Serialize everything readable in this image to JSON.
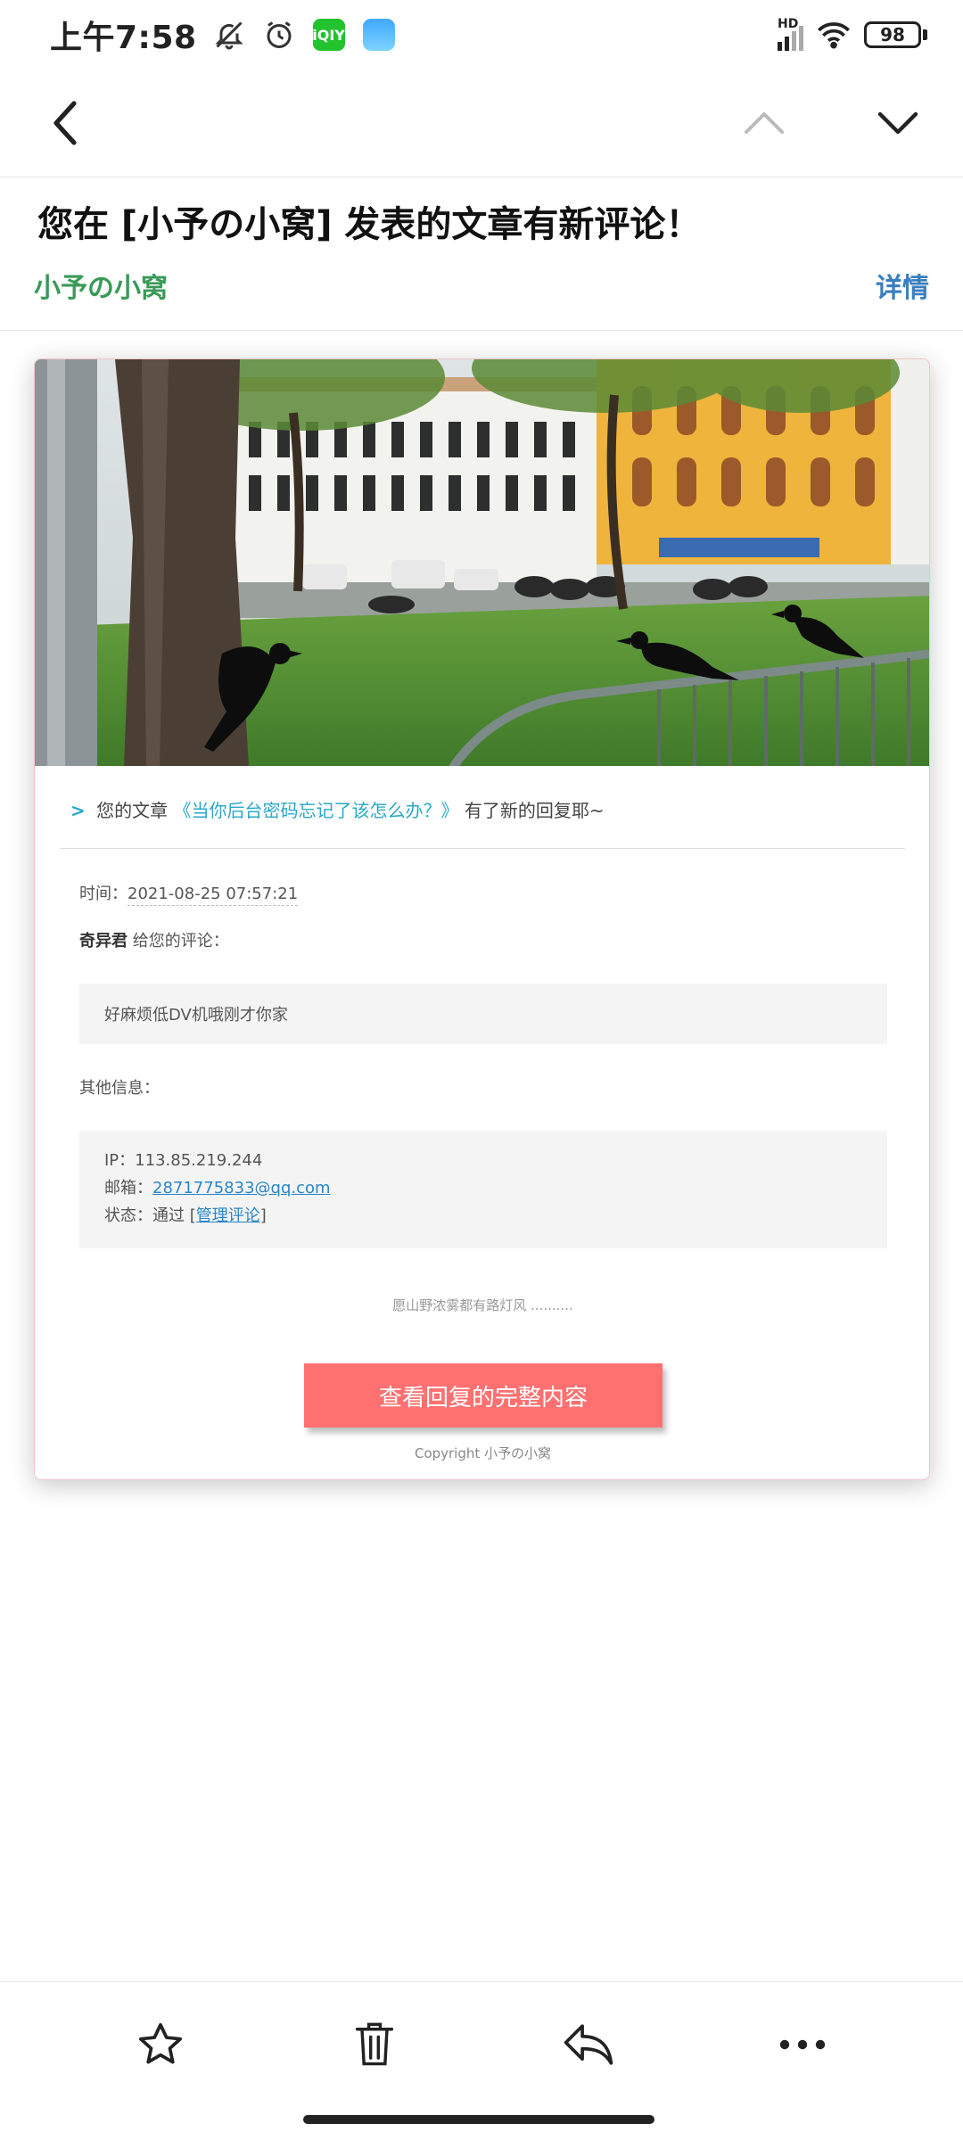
{
  "status_bar": {
    "time": "上午7:58",
    "network": "HD",
    "battery": "98",
    "app_iqiyi_label": "iQIY"
  },
  "nav": {
    "back_icon": "chevron-left-icon",
    "prev_icon": "chevron-up-icon",
    "next_icon": "chevron-down-icon"
  },
  "header": {
    "title": "您在 [小予の小窝] 发表的文章有新评论！",
    "sender": "小予の小窝",
    "detail": "详情"
  },
  "card": {
    "intro_arrow": ">",
    "intro_prefix": "您的文章",
    "article_title": "《当你后台密码忘记了该怎么办？》",
    "intro_suffix": "有了新的回复耶~",
    "time_label": "时间：",
    "time_value": "2021-08-25 07:57:21",
    "commenter_name": "奇异君",
    "commenter_suffix": " 给您的评论：",
    "comment_text": "好麻烦低DV机哦刚才你家",
    "other_label": "其他信息：",
    "ip_label": "IP：",
    "ip_value": "113.85.219.244",
    "email_label": "邮箱：",
    "email_value": "2871775833@qq.com",
    "status_label": "状态：通过 [",
    "status_link": "管理评论",
    "status_suffix": "]",
    "quote": "愿山野浓雾都有路灯风 ..........",
    "cta_label": "查看回复的完整内容",
    "copyright": "Copyright 小予の小窝"
  },
  "toolbar": {
    "items": [
      "star-icon",
      "trash-icon",
      "reply-icon",
      "more-icon"
    ]
  },
  "colors": {
    "sender": "#3a9a57",
    "detail": "#3a7ebf",
    "cta": "#ff7070",
    "link": "#2aa8c8"
  }
}
